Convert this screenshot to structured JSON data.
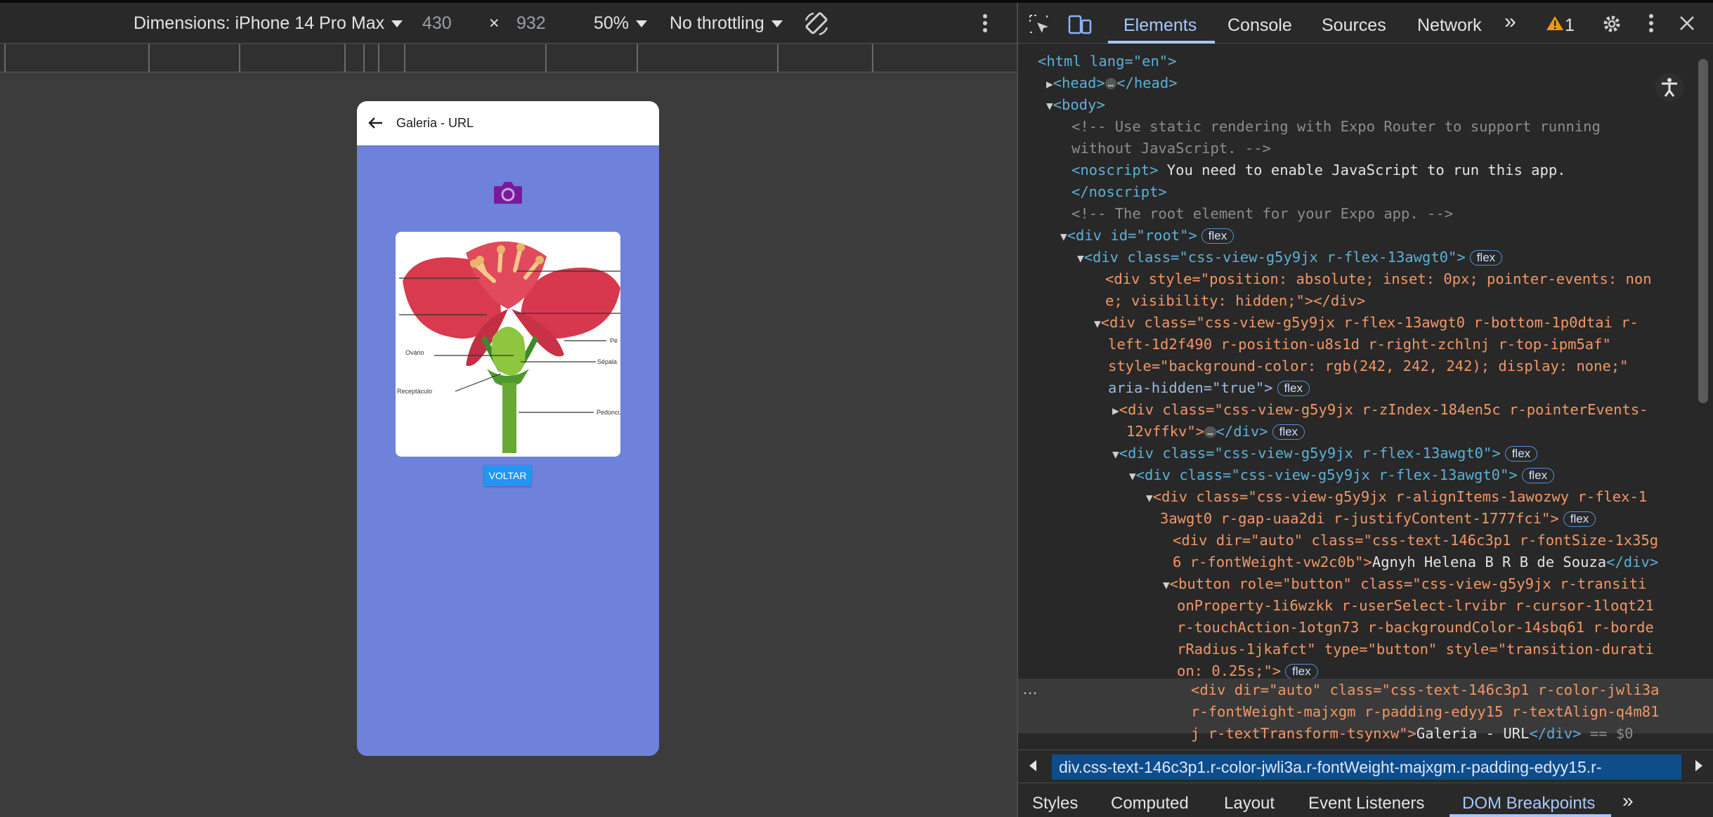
{
  "device_toolbar": {
    "dimensions_label": "Dimensions: iPhone 14 Pro Max",
    "width": "430",
    "times": "×",
    "height": "932",
    "zoom": "50%",
    "throttling": "No throttling"
  },
  "app": {
    "title": "Galeria - URL",
    "image_labels": [
      "Pé",
      "Sépala",
      "Ovário",
      "Receptáculo",
      "Pedúncu"
    ],
    "back_button_label": "VOLTAR",
    "colors": {
      "background": "#6e82dc",
      "camera": "#7a1a9a",
      "button": "#2196f3"
    }
  },
  "devtools": {
    "tabs": [
      "Elements",
      "Console",
      "Sources",
      "Network"
    ],
    "more_tabs": "»",
    "warning_count": "1",
    "code_lines": [
      "<html lang=\"en\">",
      "<head>",
      "</head>",
      "<body>",
      "<!-- Use static rendering with Expo Router to support running",
      "without JavaScript. -->",
      "<noscript>",
      " You need to enable JavaScript to run this app.",
      "</noscript>",
      "<!-- The root element for your Expo app. -->",
      "<div id=\"root\">",
      "<div class=\"css-view-g5y9jx r-flex-13awgt0\">",
      "<div style=\"position: absolute; inset: 0px; pointer-events: non",
      "e; visibility: hidden;\"></div>",
      "<div class=\"css-view-g5y9jx r-flex-13awgt0 r-bottom-1p0dtai r-",
      "left-1d2f490 r-position-u8s1d r-right-zchlnj r-top-ipm5af\"",
      "style=\"background-color: rgb(242, 242, 242); display: none;\"",
      "aria-hidden=\"true\">",
      "<div class=\"css-view-g5y9jx r-zIndex-184en5c r-pointerEvents-",
      "12vffkv\">",
      "</div>",
      "<div class=\"css-view-g5y9jx r-flex-13awgt0\">",
      "<div class=\"css-view-g5y9jx r-flex-13awgt0\">",
      "<div class=\"css-view-g5y9jx r-alignItems-1awozwy r-flex-1",
      "3awgt0 r-gap-uaa2di r-justifyContent-1777fci\">",
      "<div dir=\"auto\" class=\"css-text-146c3p1 r-fontSize-1x35g",
      "6 r-fontWeight-vw2c0b\">",
      "Agnyh Helena B R B de Souza",
      "</div>",
      "<button role=\"button\" class=\"css-view-g5y9jx r-transiti",
      "onProperty-1i6wzkk r-userSelect-lrvibr r-cursor-1loqt21",
      "r-touchAction-1otgn73 r-backgroundColor-14sbq61 r-borde",
      "rRadius-1jkafct\" type=\"button\" style=\"transition-durati",
      "on: 0.25s;\">",
      "<div dir=\"auto\" class=\"css-text-146c3p1 r-color-jwli3a",
      "r-fontWeight-majxgm r-padding-edyy15 r-textAlign-q4m81",
      "j r-textTransform-tsynxw\">",
      "Galeria - URL",
      "</div>",
      " == $0"
    ],
    "flex_badge": "flex",
    "dots": "…",
    "breadcrumb": "div.css-text-146c3p1.r-color-jwli3a.r-fontWeight-majxgm.r-padding-edyy15.r-",
    "bottom_tabs": [
      "Styles",
      "Computed",
      "Layout",
      "Event Listeners",
      "DOM Breakpoints"
    ],
    "bottom_more": "»"
  }
}
